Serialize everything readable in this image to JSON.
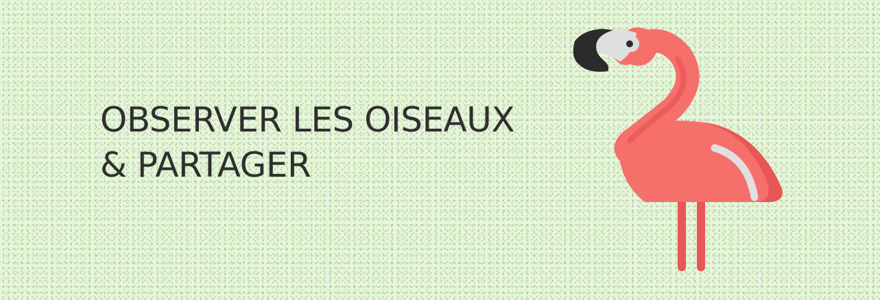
{
  "headline": {
    "line1": "OBSERVER LES OISEAUX",
    "line2": "& PARTAGER"
  },
  "illustration": {
    "icon": "flamingo-icon",
    "colors": {
      "body": "#f56f6b",
      "body_shadow": "#e85656",
      "beak_black": "#2b2b2b",
      "beak_white": "#dedede",
      "wing_highlight": "#e0e0e0"
    }
  },
  "colors": {
    "background": "#e4f7d6",
    "text": "#2f2f2f"
  }
}
